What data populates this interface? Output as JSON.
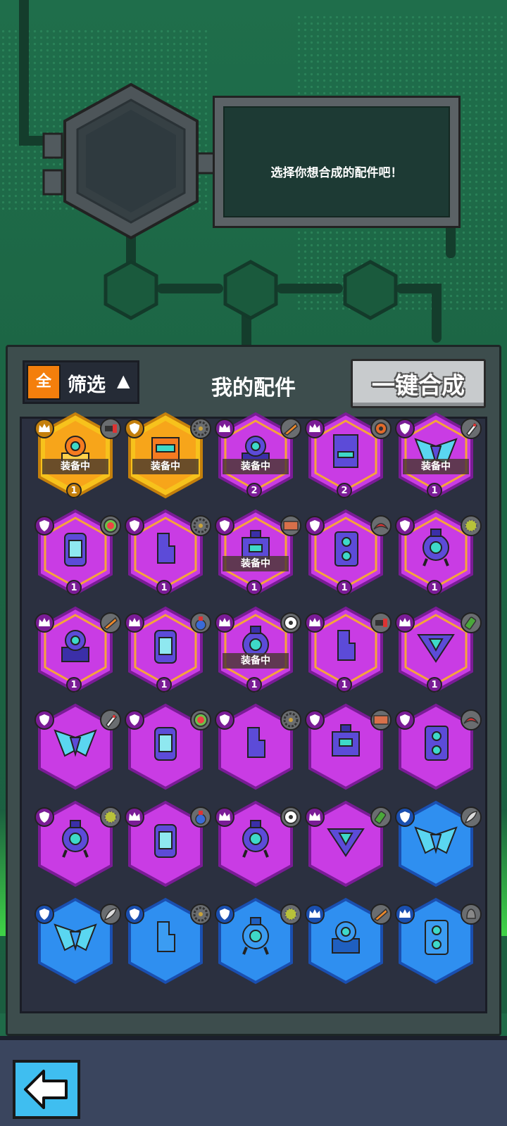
{
  "message": {
    "text": "选择你想合成的配件吧！"
  },
  "toolbar": {
    "filter_all_label": "全",
    "filter_label": "筛选",
    "filter_arrow": "▲",
    "title": "我的配件",
    "merge_label": "一键合成"
  },
  "colors": {
    "gold": "#f7c21c",
    "purple": "#c93ce4",
    "blue": "#2f8ff0",
    "orange_accent": "#f47f0c"
  },
  "items": [
    {
      "rarity": "gold",
      "badge": "crown",
      "type": "gun",
      "art": "turret",
      "equipped": "装备中",
      "level": "1"
    },
    {
      "rarity": "gold",
      "badge": "shield",
      "type": "saw",
      "art": "orange-box",
      "equipped": "装备中",
      "level": ""
    },
    {
      "rarity": "purple",
      "badge": "crown",
      "type": "drill",
      "art": "turret",
      "equipped": "装备中",
      "level": "2"
    },
    {
      "rarity": "purple",
      "badge": "crown",
      "type": "gear",
      "art": "tall-box",
      "equipped": "",
      "level": "2"
    },
    {
      "rarity": "purple",
      "badge": "shield",
      "type": "rocket",
      "art": "wings",
      "equipped": "装备中",
      "level": "1"
    },
    {
      "rarity": "purple",
      "badge": "shield",
      "type": "melon",
      "art": "capsule",
      "equipped": "",
      "level": "1"
    },
    {
      "rarity": "purple",
      "badge": "shield",
      "type": "saw",
      "art": "block",
      "equipped": "",
      "level": "1"
    },
    {
      "rarity": "purple",
      "badge": "shield",
      "type": "brick",
      "art": "box",
      "equipped": "装备中",
      "level": "1"
    },
    {
      "rarity": "purple",
      "badge": "shield",
      "type": "boomerang",
      "art": "speaker",
      "equipped": "",
      "level": "1"
    },
    {
      "rarity": "purple",
      "badge": "shield",
      "type": "spiky",
      "art": "robot",
      "equipped": "",
      "level": "1"
    },
    {
      "rarity": "purple",
      "badge": "crown",
      "type": "drill",
      "art": "turret",
      "equipped": "",
      "level": "1"
    },
    {
      "rarity": "purple",
      "badge": "crown",
      "type": "potion",
      "art": "capsule",
      "equipped": "",
      "level": "1"
    },
    {
      "rarity": "purple",
      "badge": "crown",
      "type": "ball",
      "art": "robot",
      "equipped": "装备中",
      "level": "1"
    },
    {
      "rarity": "purple",
      "badge": "crown",
      "type": "gun",
      "art": "block",
      "equipped": "",
      "level": "1"
    },
    {
      "rarity": "purple",
      "badge": "crown",
      "type": "bottle",
      "art": "triangle",
      "equipped": "",
      "level": "1"
    },
    {
      "rarity": "purple",
      "badge": "shield",
      "type": "rocket",
      "art": "wings",
      "equipped": "",
      "level": ""
    },
    {
      "rarity": "purple",
      "badge": "shield",
      "type": "melon",
      "art": "capsule",
      "equipped": "",
      "level": ""
    },
    {
      "rarity": "purple",
      "badge": "shield",
      "type": "saw",
      "art": "block",
      "equipped": "",
      "level": ""
    },
    {
      "rarity": "purple",
      "badge": "shield",
      "type": "brick",
      "art": "box",
      "equipped": "",
      "level": ""
    },
    {
      "rarity": "purple",
      "badge": "shield",
      "type": "boomerang",
      "art": "speaker",
      "equipped": "",
      "level": ""
    },
    {
      "rarity": "purple",
      "badge": "shield",
      "type": "spiky",
      "art": "robot",
      "equipped": "",
      "level": ""
    },
    {
      "rarity": "purple",
      "badge": "crown",
      "type": "potion",
      "art": "capsule",
      "equipped": "",
      "level": ""
    },
    {
      "rarity": "purple",
      "badge": "crown",
      "type": "ball",
      "art": "robot",
      "equipped": "",
      "level": ""
    },
    {
      "rarity": "purple",
      "badge": "crown",
      "type": "bottle",
      "art": "triangle",
      "equipped": "",
      "level": ""
    },
    {
      "rarity": "blue",
      "badge": "shield",
      "type": "feather",
      "art": "wings",
      "equipped": "",
      "level": ""
    },
    {
      "rarity": "blue",
      "badge": "shield",
      "type": "feather",
      "art": "wings",
      "equipped": "",
      "level": ""
    },
    {
      "rarity": "blue",
      "badge": "shield",
      "type": "saw",
      "art": "block",
      "equipped": "",
      "level": ""
    },
    {
      "rarity": "blue",
      "badge": "shield",
      "type": "spiky",
      "art": "robot",
      "equipped": "",
      "level": ""
    },
    {
      "rarity": "blue",
      "badge": "crown",
      "type": "drill",
      "art": "turret",
      "equipped": "",
      "level": ""
    },
    {
      "rarity": "blue",
      "badge": "crown",
      "type": "bell",
      "art": "speaker",
      "equipped": "",
      "level": ""
    }
  ]
}
